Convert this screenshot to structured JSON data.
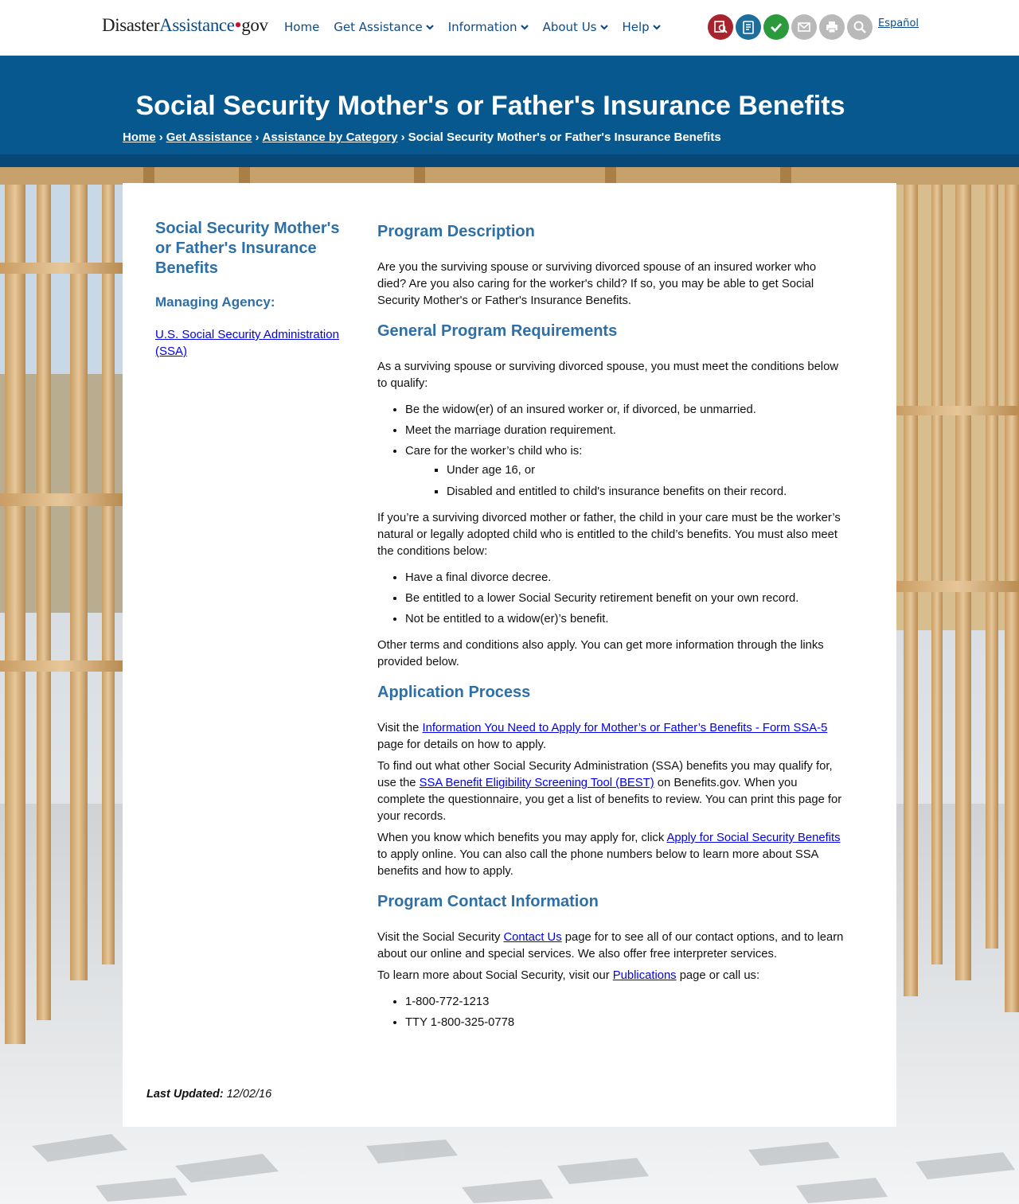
{
  "header": {
    "logo": {
      "part1": "Disaster",
      "part2": "Assistance",
      "part3": "gov"
    },
    "nav": [
      {
        "label": "Home",
        "dropdown": false
      },
      {
        "label": "Get Assistance",
        "dropdown": true
      },
      {
        "label": "Information",
        "dropdown": true
      },
      {
        "label": "About Us",
        "dropdown": true
      },
      {
        "label": "Help",
        "dropdown": true
      }
    ],
    "tool_icons": [
      {
        "name": "find-assistance-icon",
        "color": "#a8232e"
      },
      {
        "name": "apply-online-icon",
        "color": "#1e6e9c"
      },
      {
        "name": "check-status-icon",
        "color": "#2a9a3c"
      },
      {
        "name": "email-icon",
        "color": "#b9b9b9"
      },
      {
        "name": "print-icon",
        "color": "#b9b9b9"
      },
      {
        "name": "search-icon",
        "color": "#b9b9b9"
      }
    ],
    "language_link": "Español"
  },
  "banner": {
    "title": "Social Security Mother's or Father's Insurance Benefits",
    "breadcrumb": [
      "Home",
      "Get Assistance",
      "Assistance by Category",
      "Social Security Mother's or Father's Insurance Benefits"
    ],
    "color": "#07588f"
  },
  "sidebar": {
    "title": "Social Security Mother's or Father's Insurance Benefits",
    "agency_label": "Managing Agency:",
    "agency_link": "U.S. Social Security Administration (SSA)"
  },
  "main": {
    "program_description": {
      "heading": "Program Description",
      "text": "Are you the surviving spouse or surviving divorced spouse of an insured worker who died? Are you also caring for the worker's child? If so, you may be able to get Social Security Mother's or Father's Insurance Benefits."
    },
    "requirements": {
      "heading": "General Program Requirements",
      "intro": "As a surviving spouse or surviving divorced spouse, you must meet the conditions below to qualify:",
      "items": [
        "Be the widow(er) of an insured worker or, if divorced, be unmarried.",
        "Meet the marriage duration requirement.",
        "Care for the worker’s child who is:"
      ],
      "sub_items": [
        "Under age 16, or",
        "Disabled and entitled to child's insurance benefits on their record."
      ],
      "divorced_text": "If you’re a surviving divorced mother or father, the child in your care must be the worker’s natural or legally adopted child who is entitled to the child’s benefits. You must also meet the conditions below:",
      "divorced_items": [
        "Have a final divorce decree.",
        "Be entitled to a lower Social Security retirement benefit on your own record.",
        "Not be entitled to a widow(er)’s benefit."
      ],
      "other_terms": "Other terms and conditions also apply. You can get more information through the links provided below."
    },
    "application": {
      "heading": "Application Process",
      "p1_before": "Visit the ",
      "p1_link": "Information You Need to Apply for Mother’s or Father’s Benefits - Form SSA-5",
      "p1_after": " page for details on how to apply.",
      "p2_before": "To find out what other Social Security Administration (SSA) benefits you may qualify for, use the ",
      "p2_link": "SSA Benefit Eligibility Screening Tool (BEST)",
      "p2_after": " on Benefits.gov. When you complete the questionnaire, you get a list of benefits to review. You can print this page for your records.",
      "p3_before": "When you know which benefits you may apply for, click ",
      "p3_link": "Apply for Social Security Benefits",
      "p3_after": " to apply online. You can also call the phone numbers below to learn more about SSA benefits and how to apply."
    },
    "contact": {
      "heading": "Program Contact Information",
      "p1_before": "Visit the Social Security ",
      "p1_link": "Contact Us",
      "p1_after": " page for to see all of our contact options, and to learn about our online and special services. We also offer free interpreter services.",
      "p2_before": "To learn more about Social Security, visit our ",
      "p2_link": "Publications",
      "p2_after": " page or call us:",
      "phones": [
        "1-800-772-1213",
        "TTY 1-800-325-0778"
      ]
    }
  },
  "footer": {
    "last_updated_label": "Last Updated:",
    "last_updated_value": "12/02/16"
  }
}
